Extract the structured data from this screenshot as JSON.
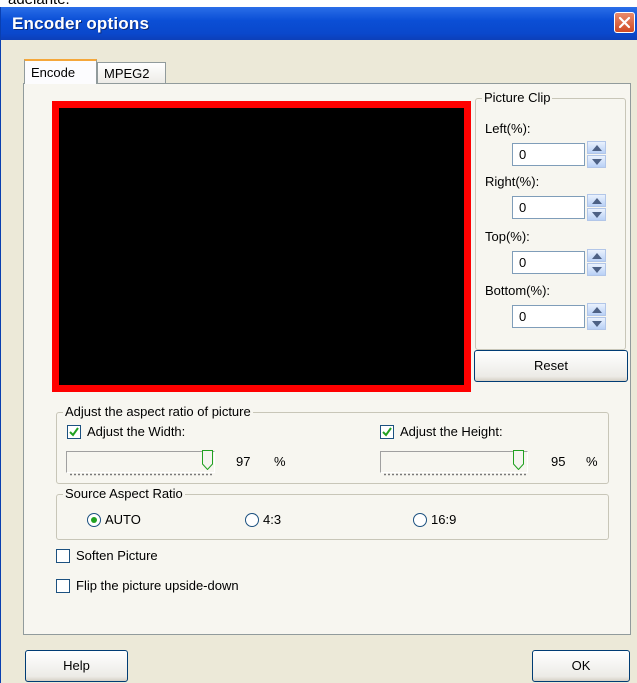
{
  "above_text": "adelante.",
  "window": {
    "title": "Encoder options"
  },
  "tabs": [
    {
      "label": "Encode"
    },
    {
      "label": "MPEG2"
    }
  ],
  "picture_clip": {
    "group_label": "Picture Clip",
    "left": {
      "label": "Left(%):",
      "value": "0"
    },
    "right": {
      "label": "Right(%):",
      "value": "0"
    },
    "top": {
      "label": "Top(%):",
      "value": "0"
    },
    "bottom": {
      "label": "Bottom(%):",
      "value": "0"
    },
    "reset_label": "Reset"
  },
  "aspect": {
    "group_label": "Adjust the aspect ratio of picture",
    "width_label": "Adjust the Width:",
    "width_checked": true,
    "width_value": "97",
    "width_unit": "%",
    "height_label": "Adjust the Height:",
    "height_checked": true,
    "height_value": "95",
    "height_unit": "%"
  },
  "source_aspect": {
    "group_label": "Source Aspect Ratio",
    "options": [
      "AUTO",
      "4:3",
      "16:9"
    ],
    "selected": "AUTO"
  },
  "options": {
    "soften_label": "Soften Picture",
    "soften_checked": false,
    "flip_label": "Flip the picture upside-down",
    "flip_checked": false
  },
  "footer": {
    "help_label": "Help",
    "ok_label": "OK"
  },
  "colors": {
    "preview_border": "#ff0000",
    "preview_fill": "#000000",
    "titlebar": "#0b4fd6"
  }
}
